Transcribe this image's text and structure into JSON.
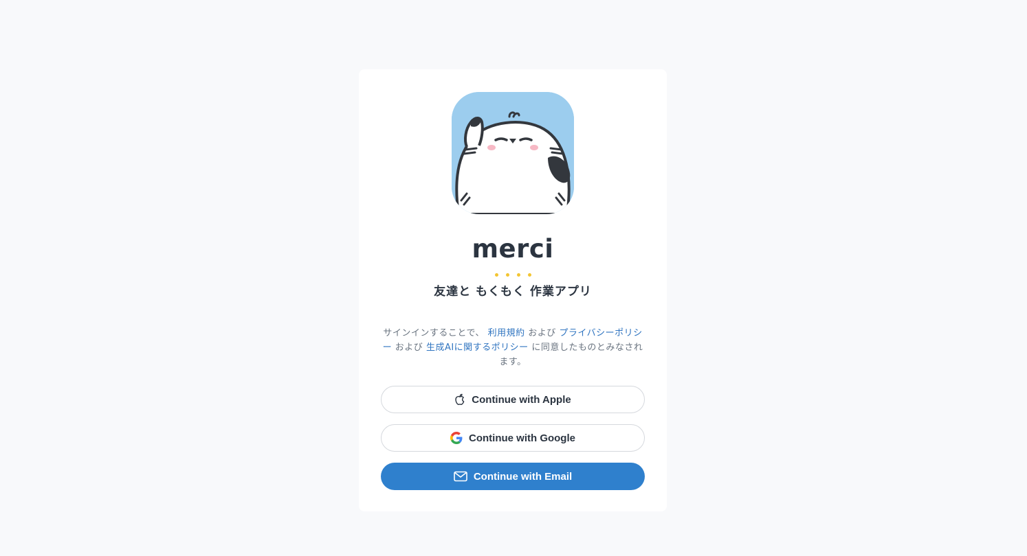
{
  "app": {
    "name": "merci",
    "tagline": "友達と もくもく 作業アプリ"
  },
  "terms": {
    "prefix": "サインインすることで、",
    "terms_link": "利用規約",
    "and_1": "および",
    "privacy_link": "プライバシーポリシー",
    "and_2": "および",
    "ai_policy_link": "生成AIに関するポリシー",
    "suffix": "に同意したものとみなされます。"
  },
  "buttons": {
    "apple": {
      "label": "Continue with Apple",
      "icon": "apple-icon"
    },
    "google": {
      "label": "Continue with Google",
      "icon": "google-icon"
    },
    "email": {
      "label": "Continue with Email",
      "icon": "mail-icon"
    }
  },
  "colors": {
    "accent": "#2f80cd",
    "link": "#2f74c0",
    "logo_background": "#9ccdee",
    "tagline_dots": "#f3c532"
  }
}
